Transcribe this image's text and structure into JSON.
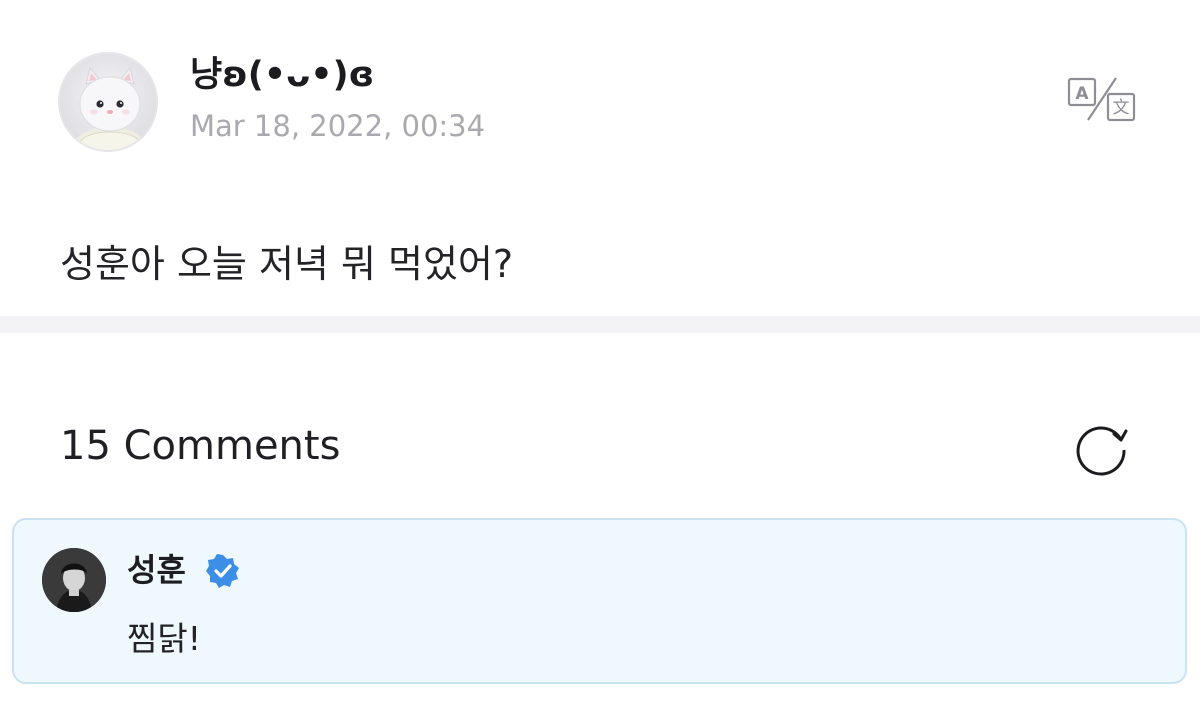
{
  "post": {
    "author_name": "냥ʚ(•ᴗ•)ɞ",
    "date": "Mar 18, 2022, 00:34",
    "body": "성훈아 오늘 저녁 뭐 먹었어?",
    "avatar_icon": "white-cat-plush-avatar"
  },
  "toolbar": {
    "translate_icon": "translate-icon"
  },
  "comments": {
    "count_label": "15 Comments",
    "refresh_icon": "refresh-icon",
    "items": [
      {
        "author": "성훈",
        "verified": true,
        "text": "찜닭!",
        "avatar_icon": "user-photo-avatar"
      }
    ]
  },
  "colors": {
    "comment_highlight_bg": "#eef8fd",
    "comment_highlight_border": "#c8e3f2",
    "verified_blue": "#3d8ee6",
    "muted_text": "#a9a9b0",
    "divider": "#f3f3f6"
  }
}
